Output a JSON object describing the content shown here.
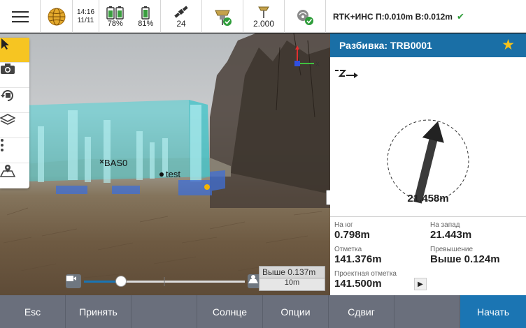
{
  "status": {
    "time": "14:16",
    "date": "11/11",
    "battery_1": "78%",
    "battery_2": "81%",
    "satellites": "24",
    "antenna_height": "2.000",
    "rtk_status": "RTK+ИНС П:0.010m В:0.012m",
    "icons": [
      "menu-icon",
      "globe-icon",
      "battery-icon",
      "satellite-icon",
      "receiver-icon",
      "antenna-icon",
      "radio-icon",
      "checkmark-icon"
    ]
  },
  "viewport": {
    "label_base": "BAS0",
    "label_point": "test",
    "scale_height": "Выше 0.137m",
    "scale_distance": "10m",
    "tools": [
      "select-tool",
      "camera-tool",
      "rotate-tool",
      "layers-tool",
      "more-tool",
      "map-tool"
    ]
  },
  "panel": {
    "title": "Разбивка: TRB0001",
    "distance": "21.458m",
    "readouts": {
      "south_label": "На юг",
      "south_value": "0.798m",
      "west_label": "На запад",
      "west_value": "21.443m",
      "elevation_label": "Отметка",
      "elevation_value": "141.376m",
      "excess_label": "Превышение",
      "excess_value": "Выше 0.124m",
      "design_label": "Проектная отметка",
      "design_value": "141.500m"
    }
  },
  "bottombar": {
    "esc": "Esc",
    "accept": "Принять",
    "sun": "Солнце",
    "options": "Опции",
    "shift": "Сдвиг",
    "start": "Начать"
  },
  "colors": {
    "header_blue": "#1a6fa6",
    "bottom_bar": "#6a6f7c",
    "primary_button": "#1b75b3",
    "star": "#f5c21b",
    "model_cyan": "#4fd2d6",
    "tool_active": "#f6c522"
  }
}
